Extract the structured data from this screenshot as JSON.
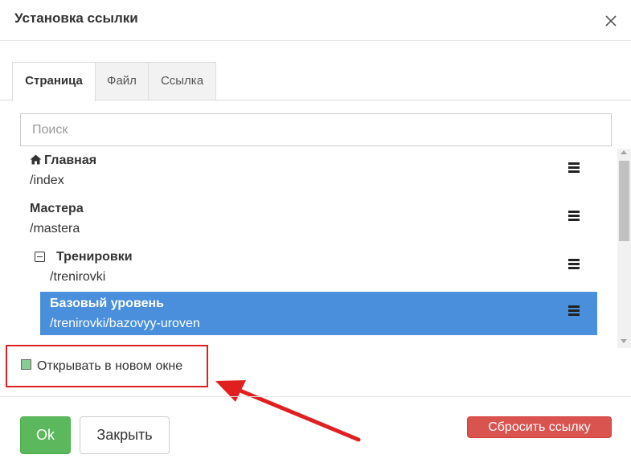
{
  "dialog": {
    "title": "Установка ссылки"
  },
  "tabs": [
    {
      "label": "Страница",
      "active": true
    },
    {
      "label": "Файл",
      "active": false
    },
    {
      "label": "Ссылка",
      "active": false
    }
  ],
  "search": {
    "placeholder": "Поиск",
    "value": ""
  },
  "tree": [
    {
      "title": "Главная",
      "path": "/index",
      "icon": "home-icon",
      "selected": false
    },
    {
      "title": "Мастера",
      "path": "/mastera",
      "selected": false
    },
    {
      "title": "Тренировки",
      "path": "/trenirovki",
      "icon": "collapse-icon",
      "selected": false
    },
    {
      "title": "Базовый уровень",
      "path": "/trenirovki/bazovyy-uroven",
      "selected": true
    }
  ],
  "options": {
    "open_new_window_label": "Открывать в новом окне",
    "open_new_window_checked": false
  },
  "footer": {
    "ok_label": "Ok",
    "close_label": "Закрыть",
    "reset_label": "Сбросить ссылку"
  },
  "colors": {
    "selected_row": "#4a8fdb",
    "ok_button": "#5cb85c",
    "reset_button": "#d9534f",
    "annotation": "#e02020"
  }
}
